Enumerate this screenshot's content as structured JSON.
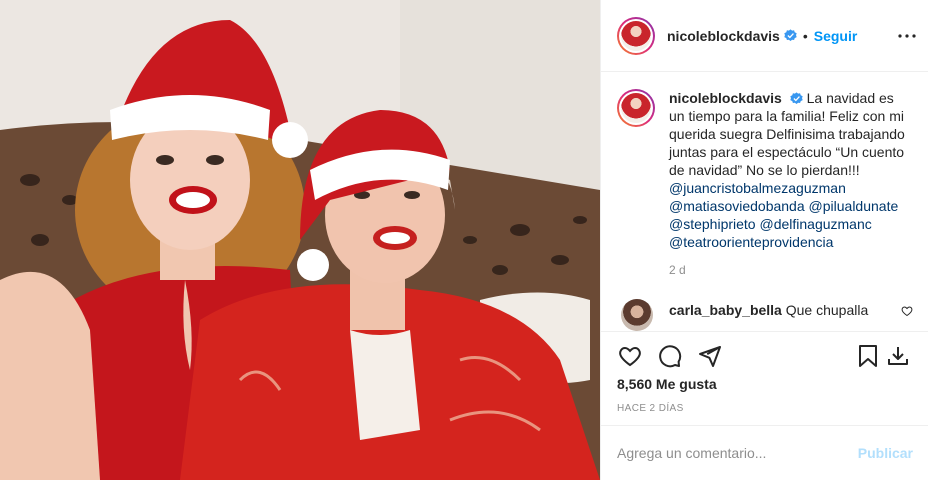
{
  "photo": {
    "description_icon": "photo-image"
  },
  "header": {
    "username": "nicoleblockdavis",
    "dot": "•",
    "follow_label": "Seguir",
    "more_icon": "more-horizontal-icon"
  },
  "caption": {
    "username": "nicoleblockdavis",
    "text": "La navidad es un tiempo para la familia! Feliz con mi querida suegra Delfinisima trabajando juntas para el espectáculo “Un cuento de navidad” No se lo pierdan!!!",
    "mentions": [
      "@juancristobalmezaguzman",
      "@matiasoviedobanda @pilualdunate",
      "@stephiprieto @delfinaguzmanc",
      "@teatroorienteprovidencia"
    ],
    "time": "2 d"
  },
  "comments": [
    {
      "username": "carla_baby_bella",
      "text": "Que chupalla"
    }
  ],
  "actions": {
    "like_icon": "heart-icon",
    "comment_icon": "comment-icon",
    "share_icon": "share-icon",
    "save_icon": "bookmark-icon",
    "download_icon": "download-icon"
  },
  "likes": "8,560 Me gusta",
  "ago": "HACE 2 DÍAS",
  "add_comment": {
    "placeholder": "Agrega un comentario...",
    "publish_label": "Publicar"
  },
  "colors": {
    "link": "#0095f6",
    "mention": "#00376b",
    "muted": "#8e8e8e",
    "publish_disabled": "#b2dffc"
  }
}
